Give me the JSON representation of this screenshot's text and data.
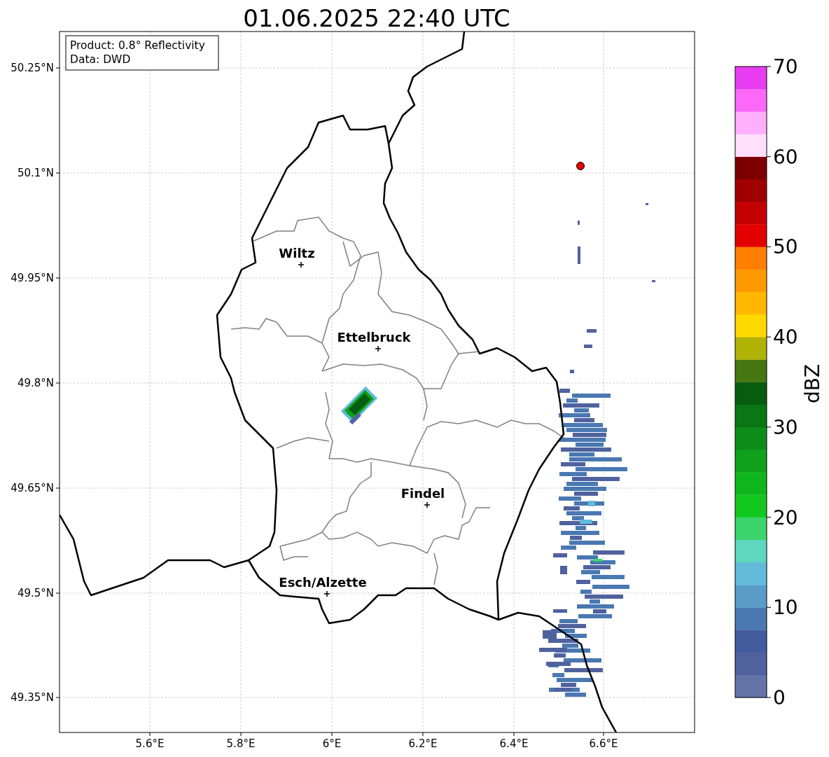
{
  "title": "01.06.2025 22:40 UTC",
  "legend": [
    "Product: 0.8° Reflectivity",
    "Data: DWD"
  ],
  "x_ticks": [
    "5.6°E",
    "5.8°E",
    "6°E",
    "6.2°E",
    "6.4°E",
    "6.6°E"
  ],
  "y_ticks": [
    "50.25°N",
    "50.1°N",
    "49.95°N",
    "49.8°N",
    "49.65°N",
    "49.5°N",
    "49.35°N"
  ],
  "cities": [
    {
      "name": "Wiltz"
    },
    {
      "name": "Ettelbruck"
    },
    {
      "name": "Findel"
    },
    {
      "name": "Esch/Alzette"
    }
  ],
  "colorbar": {
    "label": "dBZ",
    "ticks": [
      "70",
      "60",
      "50",
      "40",
      "30",
      "20",
      "10",
      "0"
    ],
    "bins": [
      {
        "color": "#6574a8"
      },
      {
        "color": "#50629e"
      },
      {
        "color": "#425c9e"
      },
      {
        "color": "#4a78b1"
      },
      {
        "color": "#5a9cc8"
      },
      {
        "color": "#62bcd9"
      },
      {
        "color": "#5fd6c0"
      },
      {
        "color": "#3cd46c"
      },
      {
        "color": "#12c81e"
      },
      {
        "color": "#10b61d"
      },
      {
        "color": "#0fa11a"
      },
      {
        "color": "#0e8c18"
      },
      {
        "color": "#0b7614"
      },
      {
        "color": "#075c0f"
      },
      {
        "color": "#467610"
      },
      {
        "color": "#b0b205"
      },
      {
        "color": "#ffd800"
      },
      {
        "color": "#ffb700"
      },
      {
        "color": "#ff9900"
      },
      {
        "color": "#ff7e00"
      },
      {
        "color": "#e30000"
      },
      {
        "color": "#c50000"
      },
      {
        "color": "#a00000"
      },
      {
        "color": "#7d0000"
      },
      {
        "color": "#ffdffb"
      },
      {
        "color": "#ffaffb"
      },
      {
        "color": "#fb68fa"
      },
      {
        "color": "#e73cf0"
      }
    ]
  }
}
